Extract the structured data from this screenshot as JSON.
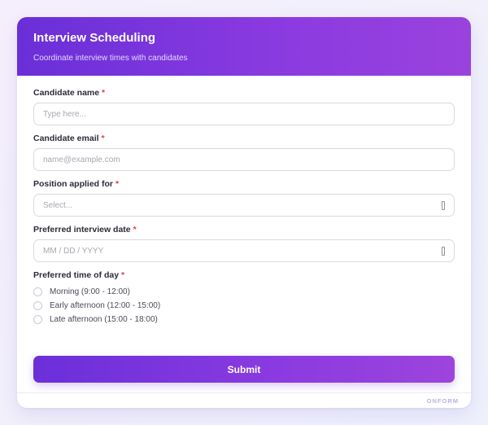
{
  "header": {
    "title": "Interview Scheduling",
    "subtitle": "Coordinate interview times with candidates"
  },
  "form": {
    "candidate_name": {
      "label": "Candidate name",
      "required_mark": "*",
      "placeholder": "Type here..."
    },
    "candidate_email": {
      "label": "Candidate email",
      "required_mark": "*",
      "placeholder": "name@example.com"
    },
    "position": {
      "label": "Position applied for",
      "required_mark": "*",
      "placeholder": "Select..."
    },
    "date": {
      "label": "Preferred interview date",
      "required_mark": "*",
      "placeholder": "MM / DD / YYYY"
    },
    "time_of_day": {
      "label": "Preferred time of day",
      "required_mark": "*",
      "options": [
        "Morning (9:00 - 12:00)",
        "Early afternoon (12:00 - 15:00)",
        "Late afternoon (15:00 - 18:00)"
      ]
    },
    "submit_label": "Submit"
  },
  "footer": {
    "brand": "ONFORM"
  },
  "colors": {
    "accent": "#7b35dc",
    "required": "#e0443e"
  },
  "icons": {
    "select_indicator": "dropdown-icon",
    "date_indicator": "calendar-icon"
  }
}
